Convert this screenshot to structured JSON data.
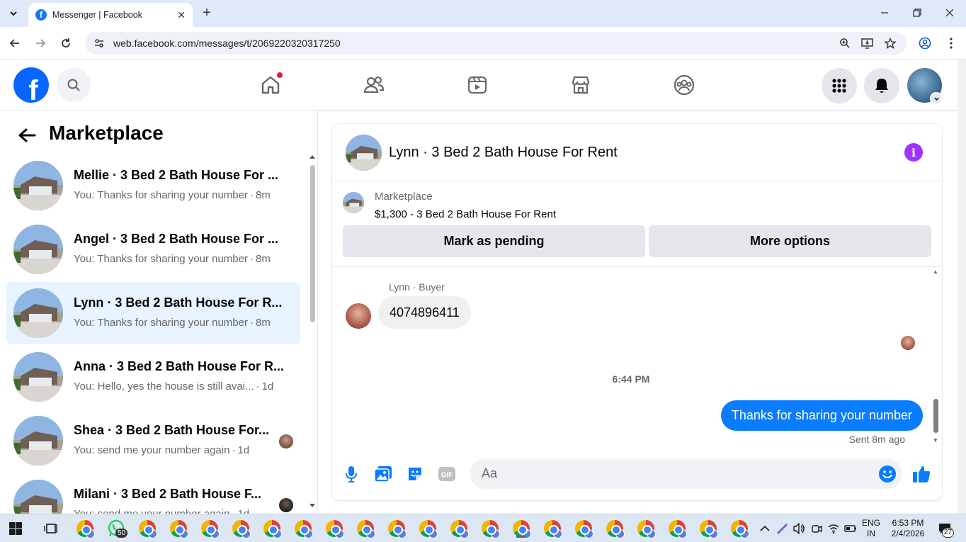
{
  "browser": {
    "tab_title": "Messenger | Facebook",
    "url": "web.facebook.com/messages/t/2069220320317250"
  },
  "left_panel": {
    "title": "Marketplace",
    "conversations": [
      {
        "name": "Mellie · 3 Bed 2 Bath House For ...",
        "preview": "You: Thanks for sharing your number",
        "time": "8m",
        "active": false
      },
      {
        "name": "Angel · 3 Bed 2 Bath House For ...",
        "preview": "You: Thanks for sharing your number",
        "time": "8m",
        "active": false
      },
      {
        "name": "Lynn · 3 Bed 2 Bath House For R...",
        "preview": "You: Thanks for sharing your number",
        "time": "8m",
        "active": true
      },
      {
        "name": "Anna · 3 Bed 2 Bath House For R...",
        "preview": "You: Hello, yes the house is still avai...",
        "time": "1d",
        "active": false
      },
      {
        "name": "Shea · 3 Bed 2 Bath House For...",
        "preview": "You: send me your number again",
        "time": "1d",
        "active": false
      },
      {
        "name": "Milani · 3 Bed 2 Bath House F...",
        "preview": "You: send me your number again",
        "time": "1d",
        "active": false
      }
    ]
  },
  "chat": {
    "title": "Lynn · 3 Bed 2 Bath House For Rent",
    "listing": {
      "source": "Marketplace",
      "title": "$1,300 - 3 Bed 2 Bath House For Rent",
      "mark_pending_label": "Mark as pending",
      "more_options_label": "More options"
    },
    "messages": {
      "sender_label": "Lynn · Buyer",
      "incoming_text": "4074896411",
      "timestamp": "6:44 PM",
      "outgoing_text": "Thanks for sharing your number",
      "sent_status": "Sent 8m ago"
    },
    "composer": {
      "placeholder": "Aa"
    }
  },
  "taskbar": {
    "whatsapp_badge": "50",
    "language_line1": "ENG",
    "language_line2": "IN",
    "time": "6:53 PM",
    "date": "2/4/2026",
    "notification_count": "27"
  },
  "colors": {
    "facebook_blue": "#0866ff",
    "messenger_blue": "#0a7cff",
    "info_purple": "#a033ff",
    "active_conv_bg": "#e7f3ff"
  }
}
